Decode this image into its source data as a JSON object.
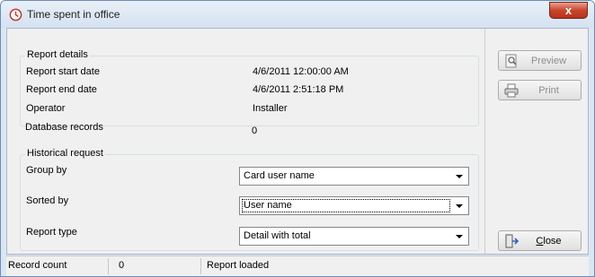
{
  "window": {
    "title": "Time spent in office",
    "title_icon": "clock-icon",
    "close_label": "x"
  },
  "report_details": {
    "legend": "Report details",
    "rows": [
      {
        "label": "Report start date",
        "value": "4/6/2011 12:00:00 AM"
      },
      {
        "label": "Report end date",
        "value": "4/6/2011 2:51:18 PM"
      },
      {
        "label": "Operator",
        "value": "Installer"
      },
      {
        "label": "Database records",
        "value": "0"
      }
    ]
  },
  "historical_request": {
    "legend": "Historical request",
    "group_by": {
      "label": "Group by",
      "value": "Card user name"
    },
    "sorted_by": {
      "label": "Sorted by",
      "value": "User name"
    },
    "report_type": {
      "label": "Report type",
      "value": "Detail with total"
    }
  },
  "buttons": {
    "preview": {
      "label": "Preview",
      "enabled": false,
      "icon": "preview-icon"
    },
    "print": {
      "label": "Print",
      "enabled": false,
      "icon": "printer-icon"
    },
    "close": {
      "label": "Close",
      "enabled": true,
      "icon": "exit-door-icon"
    }
  },
  "status": {
    "record_count_label": "Record count",
    "record_count_value": "0",
    "message": "Report loaded"
  },
  "colors": {
    "clock_icon": "#c0392b",
    "close_button": "#c9452d",
    "window_frame": "#dbe6f3"
  }
}
